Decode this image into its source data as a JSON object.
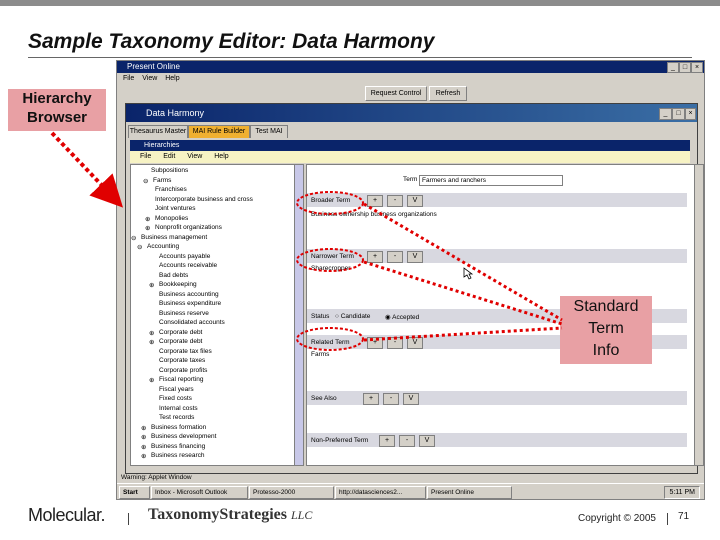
{
  "slide": {
    "title": "Sample Taxonomy Editor: Data Harmony",
    "copyright": "Copyright © 2005",
    "page": "71",
    "logo_left": "Molecular.",
    "logo_right_main": "TaxonomyStrategies",
    "logo_right_suffix": "LLC"
  },
  "outer_window": {
    "title": "Present Online",
    "menu": [
      "File",
      "View",
      "Help"
    ],
    "toolbar": {
      "request_label": "Request Control",
      "refresh_label": "Refresh"
    }
  },
  "inner_window": {
    "title": "Data Harmony",
    "tabs": [
      "Thesaurus Master",
      "MAI Rule Builder",
      "Test MAI"
    ],
    "subwindow_title": "Hierarchies",
    "submenu": [
      "File",
      "Edit",
      "View",
      "Help"
    ]
  },
  "tree": {
    "items": [
      {
        "label": "Subpositions",
        "exp": ""
      },
      {
        "label": "Farms",
        "exp": "⊖"
      },
      {
        "label": "Franchises",
        "exp": ""
      },
      {
        "label": "Intercorporate business and cross",
        "exp": ""
      },
      {
        "label": "Joint ventures",
        "exp": ""
      },
      {
        "label": "Monopolies",
        "exp": "⊕"
      },
      {
        "label": "Nonprofit organizations",
        "exp": "⊕"
      },
      {
        "label": "Business management",
        "exp": "⊖"
      },
      {
        "label": "Accounting",
        "exp": "⊖"
      },
      {
        "label": "Accounts payable",
        "exp": ""
      },
      {
        "label": "Accounts receivable",
        "exp": ""
      },
      {
        "label": "Bad debts",
        "exp": ""
      },
      {
        "label": "Bookkeeping",
        "exp": "⊕"
      },
      {
        "label": "Business accounting",
        "exp": ""
      },
      {
        "label": "Business expenditure",
        "exp": ""
      },
      {
        "label": "Business reserve",
        "exp": ""
      },
      {
        "label": "Consolidated accounts",
        "exp": ""
      },
      {
        "label": "Corporate debt",
        "exp": "⊕"
      },
      {
        "label": "Corporate debt",
        "exp": "⊕"
      },
      {
        "label": "Corporate tax files",
        "exp": ""
      },
      {
        "label": "Corporate taxes",
        "exp": ""
      },
      {
        "label": "Corporate profits",
        "exp": ""
      },
      {
        "label": "Fiscal reporting",
        "exp": "⊕"
      },
      {
        "label": "Fiscal years",
        "exp": ""
      },
      {
        "label": "Fixed costs",
        "exp": ""
      },
      {
        "label": "Internal costs",
        "exp": ""
      },
      {
        "label": "Test records",
        "exp": ""
      },
      {
        "label": "Business formation",
        "exp": "⊕"
      },
      {
        "label": "Business development",
        "exp": "⊕"
      },
      {
        "label": "Business financing",
        "exp": "⊕"
      },
      {
        "label": "Business research",
        "exp": "⊕"
      }
    ]
  },
  "term_panel": {
    "term_label": "Term",
    "term_value": "Farmers and ranchers",
    "broader_label": "Broader Term",
    "broader_desc": "Business ownership business organizations",
    "narrower_label": "Narrower Term",
    "narrower_value": "Sharecropper",
    "status_label": "Status",
    "status_candidate": "Candidate",
    "status_accepted": "Accepted",
    "related_label": "Related Term",
    "related_value": "Farms",
    "scope_label": "See Also",
    "nonpref_label": "Non-Preferred Term",
    "btn_add": "+",
    "btn_remove": "-",
    "btn_view": "V"
  },
  "status_bar": {
    "text": "Warning: Applet Window"
  },
  "taskbar": {
    "start": "Start",
    "tasks": [
      "Inbox - Microsoft Outlook",
      "Protesso-2000",
      "http://datasciences2...",
      "Present Online"
    ],
    "clock": "5:11 PM"
  },
  "callouts": {
    "hierarchy": [
      "Hierarchy",
      "Browser"
    ],
    "standard": [
      "Standard",
      "Term",
      "Info"
    ]
  },
  "colors": {
    "callout_bg": "#e8a0a4",
    "dotted_red": "#e00000",
    "title_bar": "#0a246a"
  }
}
